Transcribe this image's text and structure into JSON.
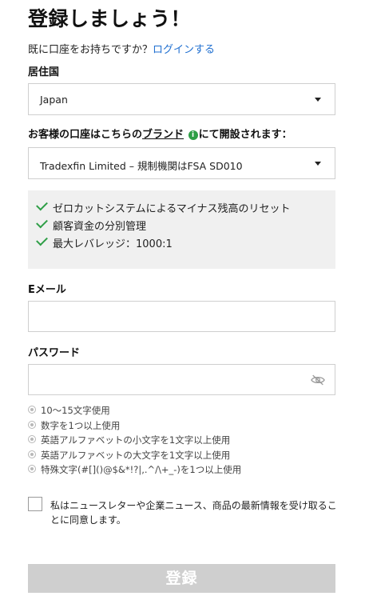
{
  "page": {
    "title": "登録しましょう！",
    "login_prompt": "既に口座をお持ちですか？",
    "login_link": "ログインする"
  },
  "residence": {
    "label": "居住国",
    "selected": "Japan"
  },
  "brand": {
    "label_before": "お客様の口座はこちらの",
    "label_link": "ブランド",
    "info_icon": "i",
    "label_after": "にて開設されます：",
    "selected": "Tradexfin Limited – 規制機関はFSA SD010"
  },
  "features": [
    "ゼロカットシステムによるマイナス残高のリセット",
    "顧客資金の分別管理",
    "最大レバレッジ：1000:1"
  ],
  "email": {
    "label": "Eメール",
    "value": ""
  },
  "password": {
    "label": "パスワード",
    "value": "",
    "toggle_icon": "eye-slash-icon",
    "rules": [
      "10〜15文字使用",
      "数字を1つ以上使用",
      "英語アルファベットの小文字を1文字以上使用",
      "英語アルファベットの大文字を1文字以上使用",
      "特殊文字(#[]()@$&*!?|,.^/\\+_-)を1つ以上使用"
    ]
  },
  "consent": {
    "checked": false,
    "text": "私はニュースレターや企業ニュース、商品の最新情報を受け取ることに同意します。"
  },
  "submit": {
    "label": "登録"
  },
  "colors": {
    "link": "#1f6fd0",
    "check": "#2e9e46",
    "submit_disabled_bg": "#cfcfcf"
  }
}
